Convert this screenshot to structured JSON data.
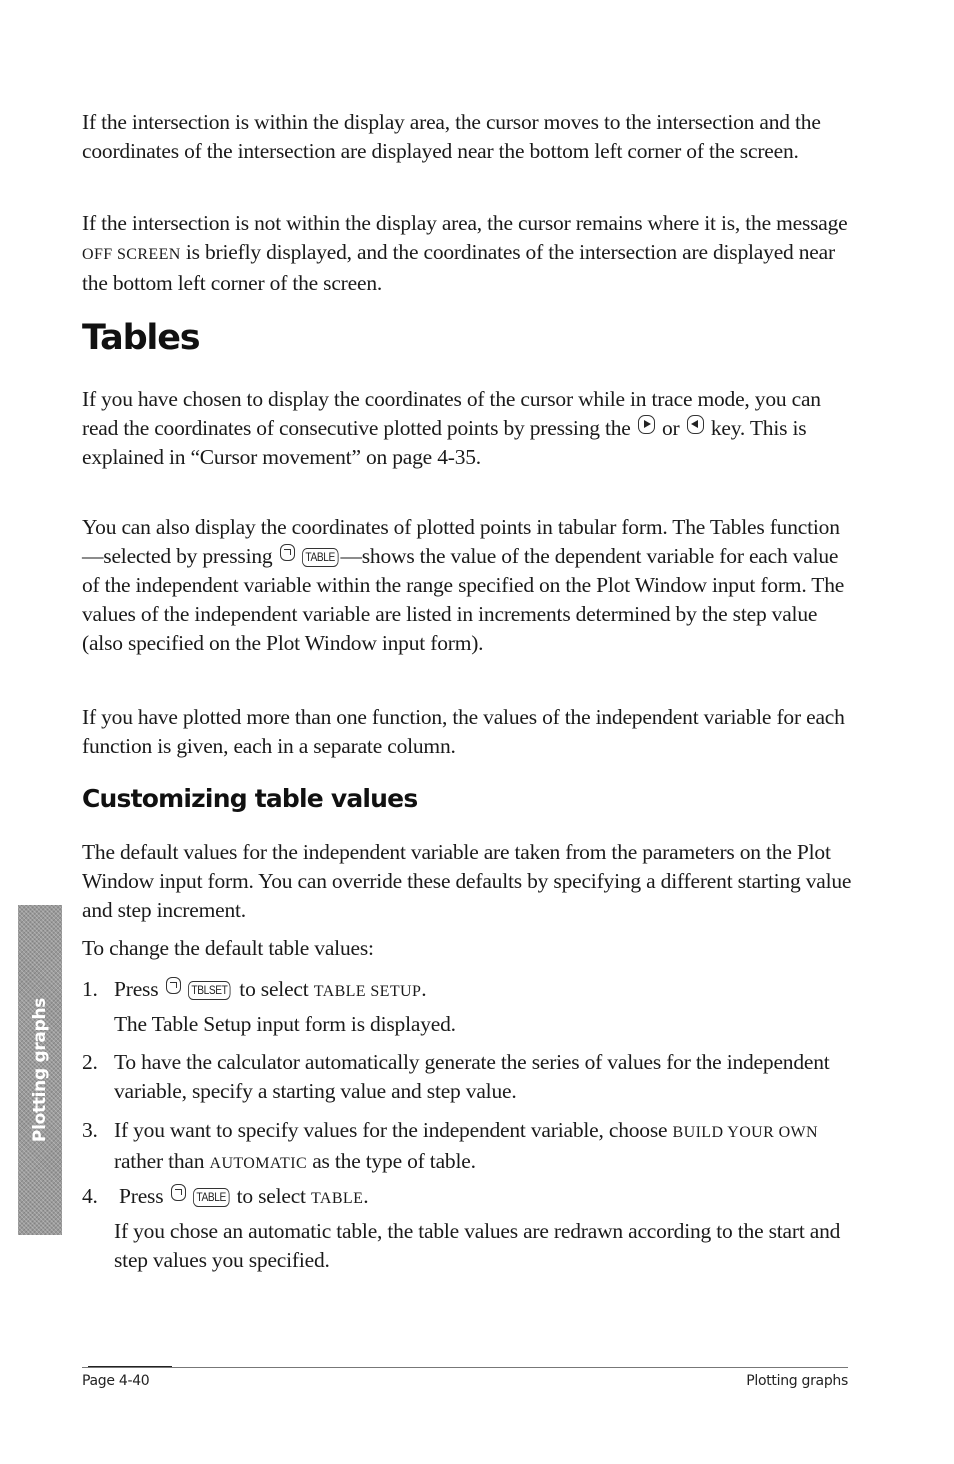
{
  "paragraphs": {
    "p1": "If the intersection is within the display area, the cursor moves to the intersection and the coordinates of the intersection are displayed near the bottom left corner of the screen.",
    "p2_a": "If the intersection is not within the display area, the cursor remains where it is, the message ",
    "p2_sc": "OFF SCREEN",
    "p2_b": " is briefly displayed, and the coordinates of the intersection are displayed near the bottom left corner of the screen."
  },
  "section": {
    "title": "Tables",
    "p3_a": "If you have chosen to display the coordinates of the cursor while in trace mode, you can read the coordinates of consecutive plotted points by pressing the ",
    "p3_or": " or ",
    "p3_b": " key. This is explained in “Cursor movement” on page 4-35.",
    "p4_a": "You can also display the coordinates of plotted points in tabular form. The Tables function—selected by pressing ",
    "p4_b": "—shows the value of the dependent variable for each value of the independent variable within the range specified on the Plot Window input form. The values of the independent variable are listed in increments determined by the step value (also specified on the Plot Window input form).",
    "p5": "If you have plotted more than one function, the values of the independent variable for each function is given, each in a separate column."
  },
  "subsection": {
    "title": "Customizing table values",
    "p6": "The default values for the independent variable are taken from the parameters on the Plot Window input form. You can override these defaults by specifying a different starting value and step increment.",
    "p7": "To change the default table values:",
    "steps": [
      {
        "num": "1.",
        "a": "Press ",
        "b": " to select ",
        "sc": "TABLE SETUP",
        "c": ".",
        "note": "The Table Setup input form is displayed."
      },
      {
        "num": "2.",
        "text": "To have the calculator automatically generate the series of values for the independent variable, specify a starting value and step value."
      },
      {
        "num": "3.",
        "a": "If you want to specify values for the independent variable, choose ",
        "sc1": "BUILD YOUR OWN",
        "b": " rather than ",
        "sc2": "AUTOMATIC",
        "c": " as the type of table."
      },
      {
        "num": "4.",
        "a": "Press ",
        "b": " to select ",
        "sc": "TABLE",
        "c": ".",
        "note": "If you chose an automatic table, the table values are redrawn according to the start and step values you specified."
      }
    ]
  },
  "keys": {
    "shift_icon": "left-shift-key-icon",
    "right_arrow": "right-arrow-key-icon",
    "left_arrow": "left-arrow-key-icon",
    "table": "TABLE",
    "tblset": "TBLSET"
  },
  "side_tab": {
    "label": "Plotting graphs"
  },
  "footer": {
    "page": "Page 4-40",
    "chapter": "Plotting graphs"
  }
}
